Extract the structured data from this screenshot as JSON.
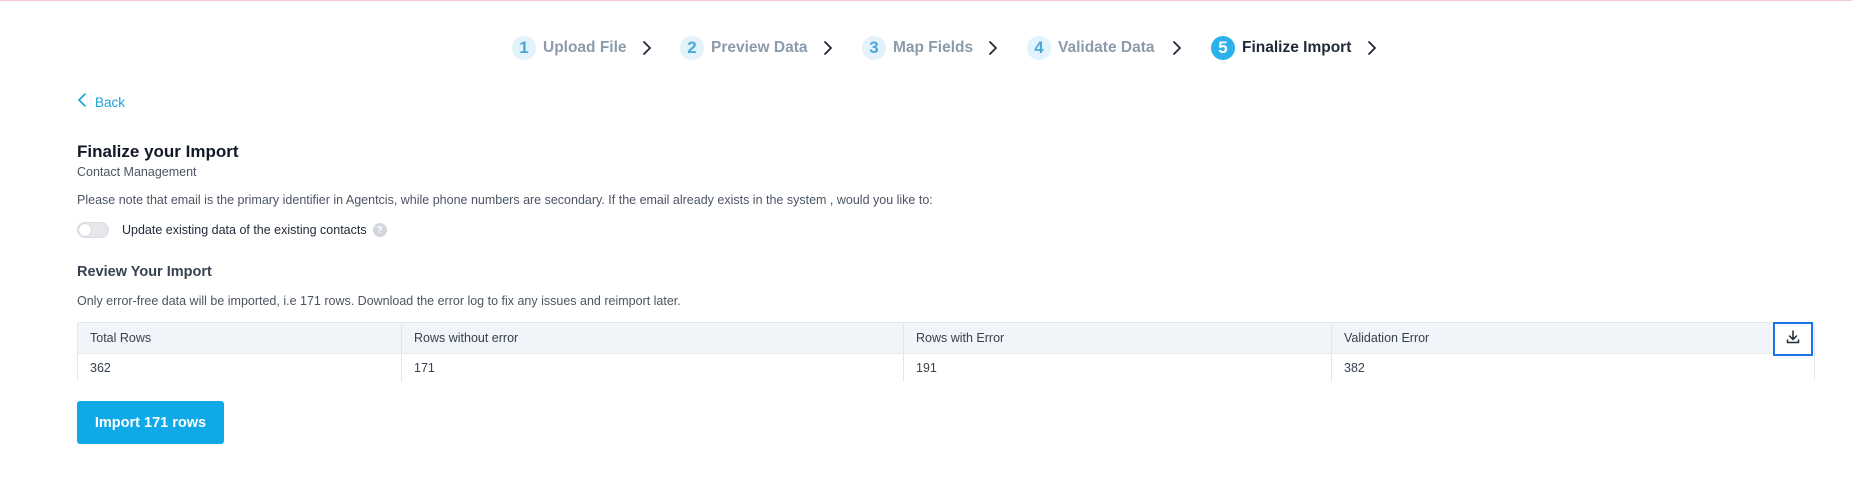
{
  "stepper": {
    "steps": [
      {
        "number": "1",
        "label": "Upload File",
        "state": "done"
      },
      {
        "number": "2",
        "label": "Preview Data",
        "state": "done"
      },
      {
        "number": "3",
        "label": "Map Fields",
        "state": "done"
      },
      {
        "number": "4",
        "label": "Validate Data",
        "state": "done"
      },
      {
        "number": "5",
        "label": "Finalize Import",
        "state": "active"
      }
    ]
  },
  "back": {
    "label": "Back",
    "icon": "chevron-left-icon"
  },
  "header": {
    "title": "Finalize your Import",
    "subtitle": "Contact Management",
    "note": "Please note that email is the primary identifier in Agentcis, while phone numbers are secondary. If the email already exists in the system , would you like to:"
  },
  "update_toggle": {
    "label": "Update existing data of the existing contacts",
    "checked": false,
    "help_icon": "question-icon"
  },
  "review": {
    "title": "Review Your Import",
    "note": "Only error-free data will be imported, i.e 171 rows. Download the error log to fix any issues and reimport later.",
    "table": {
      "headers": [
        "Total Rows",
        "Rows without error",
        "Rows with Error",
        "Validation Error"
      ],
      "row": [
        "362",
        "171",
        "191",
        "382"
      ]
    },
    "download_icon": "download-icon"
  },
  "import_button": {
    "label": "Import 171 rows"
  },
  "colors": {
    "accent": "#0fa9e8",
    "active_step": "#2cb1ea",
    "link": "#1aa2dc",
    "focus_outline": "#1a73e8"
  }
}
